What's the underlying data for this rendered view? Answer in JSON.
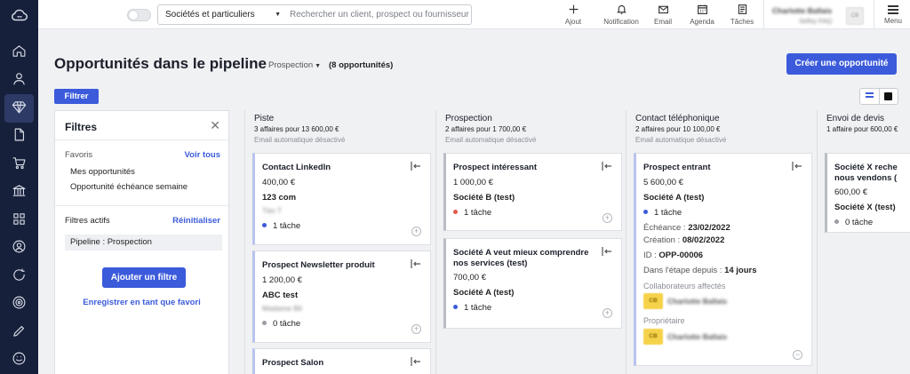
{
  "sidebar": {
    "logo": "cloud-logo",
    "items": [
      {
        "icon": "home-icon"
      },
      {
        "icon": "user-icon"
      },
      {
        "icon": "diamond-icon",
        "active": true
      },
      {
        "icon": "document-icon"
      },
      {
        "icon": "cart-icon"
      },
      {
        "icon": "bank-icon"
      },
      {
        "icon": "grid-icon"
      },
      {
        "icon": "contact-icon"
      },
      {
        "icon": "refresh-icon"
      },
      {
        "icon": "target-icon"
      },
      {
        "icon": "pencil-icon"
      },
      {
        "icon": "smile-icon"
      }
    ]
  },
  "topbar": {
    "scope_select": "Sociétés et particuliers",
    "search_placeholder": "Rechercher un client, prospect ou fournisseur",
    "actions": {
      "ajout": "Ajout",
      "notification": "Notification",
      "email": "Email",
      "agenda": "Agenda",
      "taches": "Tâches"
    },
    "user": {
      "name": "Charlotte Ballais",
      "role": "Sellsy FAQ",
      "initials": "CB"
    },
    "menu": "Menu"
  },
  "page": {
    "title": "Opportunités dans le pipeline",
    "stage_select": "Prospection",
    "count": "(8 opportunités)",
    "create_button": "Créer une opportunité",
    "filter_button": "Filtrer"
  },
  "filters": {
    "title": "Filtres",
    "favorites_label": "Favoris",
    "see_all": "Voir tous",
    "favorites": [
      "Mes opportunités",
      "Opportunité échéance semaine"
    ],
    "active_label": "Filtres actifs",
    "reset": "Réinitialiser",
    "active_chip": "Pipeline : Prospection",
    "add_filter": "Ajouter un filtre",
    "save_favorite": "Enregistrer en tant que favori"
  },
  "columns": [
    {
      "title": "Piste",
      "summary": "3 affaires pour 13 600,00 €",
      "note": "Email automatique désactivé",
      "cards": [
        {
          "title": "Contact LinkedIn",
          "amount": "400,00 €",
          "company": "123 com",
          "contact": "Téo T",
          "task": "1 tâche",
          "dot": "blue"
        },
        {
          "title": "Prospect Newsletter produit",
          "amount": "1 200,00 €",
          "company": "ABC test",
          "contact": "Madame Bli",
          "task": "0 tâche",
          "dot": "grey"
        },
        {
          "title": "Prospect Salon"
        }
      ]
    },
    {
      "title": "Prospection",
      "summary": "2 affaires pour 1 700,00 €",
      "note": "Email automatique désactivé",
      "cards": [
        {
          "title": "Prospect intéressant",
          "amount": "1 000,00 €",
          "company": "Société B (test)",
          "task": "1 tâche",
          "dot": "red"
        },
        {
          "title_line1": "Société A veut mieux comprendre",
          "title_line2": "nos services (test)",
          "amount": "700,00 €",
          "company": "Société A (test)",
          "task": "1 tâche",
          "dot": "blue"
        }
      ]
    },
    {
      "title": "Contact téléphonique",
      "summary": "2 affaires pour 10 100,00 €",
      "note": "Email automatique désactivé",
      "card": {
        "title": "Prospect entrant",
        "amount": "5 600,00 €",
        "company": "Société A (test)",
        "task": "1 tâche",
        "echeance_label": "Échéance :",
        "echeance_value": "23/02/2022",
        "creation_label": "Création :",
        "creation_value": "08/02/2022",
        "id_label": "ID :",
        "id_value": "OPP-00006",
        "stage_label": "Dans l'étape depuis :",
        "stage_value": "14 jours",
        "collab_label": "Collaborateurs affectés",
        "owner_label": "Propriétaire",
        "person_initials": "CB",
        "person_name": "Charlotte Ballais"
      }
    },
    {
      "title": "Envoi de devis",
      "summary": "1 affaire pour 600,00 €",
      "card": {
        "title_line1": "Société X reche",
        "title_line2": "nous vendons (",
        "amount": "600,00 €",
        "company": "Société X (test)",
        "task": "0 tâche"
      }
    }
  ],
  "colors": {
    "primary": "#3b5bdb",
    "sidebar": "#17203b",
    "task_red": "#e15b4a"
  }
}
